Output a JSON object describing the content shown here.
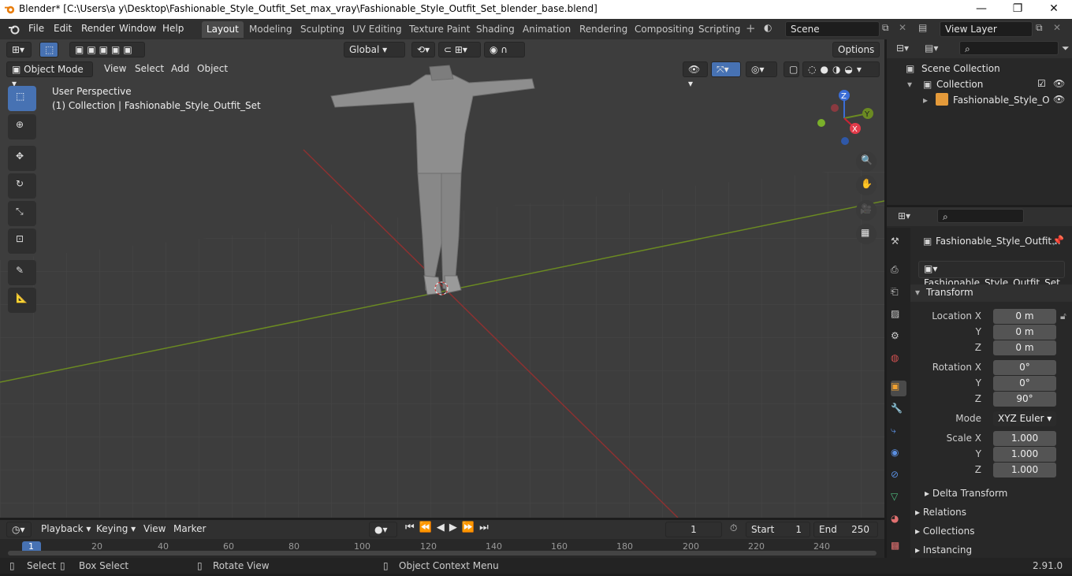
{
  "window": {
    "title": "Blender* [C:\\Users\\a y\\Desktop\\Fashionable_Style_Outfit_Set_max_vray\\Fashionable_Style_Outfit_Set_blender_base.blend]",
    "minimize": "—",
    "maximize": "❐",
    "close": "✕"
  },
  "menus": [
    "File",
    "Edit",
    "Render",
    "Window",
    "Help"
  ],
  "workspaces": [
    "Layout",
    "Modeling",
    "Sculpting",
    "UV Editing",
    "Texture Paint",
    "Shading",
    "Animation",
    "Rendering",
    "Compositing",
    "Scripting"
  ],
  "scene": {
    "name": "Scene",
    "view_layer": "View Layer"
  },
  "viewport": {
    "transform_orientation": "Global",
    "options": "Options",
    "mode": "Object Mode",
    "view_menu": [
      "View",
      "Select",
      "Add",
      "Object"
    ],
    "perspective": "User Perspective",
    "collection_info": "(1) Collection | Fashionable_Style_Outfit_Set",
    "gizmo": {
      "x": "X",
      "y": "Y",
      "z": "Z"
    }
  },
  "outliner": {
    "root": "Scene Collection",
    "collection": "Collection",
    "object": "Fashionable_Style_O"
  },
  "properties": {
    "object_name": "Fashionable_Style_Outfit...",
    "data_name": "Fashionable_Style_Outfit_Set",
    "transform_label": "Transform",
    "location": {
      "label": "Location X",
      "x": "0 m",
      "y": "0 m",
      "z": "0 m"
    },
    "rotation": {
      "label": "Rotation X",
      "x": "0°",
      "y": "0°",
      "z": "90°"
    },
    "mode": {
      "label": "Mode",
      "value": "XYZ Euler"
    },
    "scale": {
      "label": "Scale X",
      "x": "1.000",
      "y": "1.000",
      "z": "1.000"
    },
    "axis_y": "Y",
    "axis_z": "Z",
    "delta": "Delta Transform",
    "sections": [
      "Relations",
      "Collections",
      "Instancing"
    ]
  },
  "timeline": {
    "menus": [
      "Playback",
      "Keying",
      "View",
      "Marker"
    ],
    "current_frame": "1",
    "start_label": "Start",
    "start": "1",
    "end_label": "End",
    "end": "250",
    "ticks": [
      "1",
      "20",
      "40",
      "60",
      "80",
      "100",
      "120",
      "140",
      "160",
      "180",
      "200",
      "220",
      "240"
    ]
  },
  "status": {
    "select": "Select",
    "box_select": "Box Select",
    "rotate": "Rotate View",
    "context": "Object Context Menu",
    "version": "2.91.0"
  },
  "colors": {
    "accent": "#4772b3",
    "x_axis": "#8c3131",
    "y_axis": "#6b8a22"
  }
}
